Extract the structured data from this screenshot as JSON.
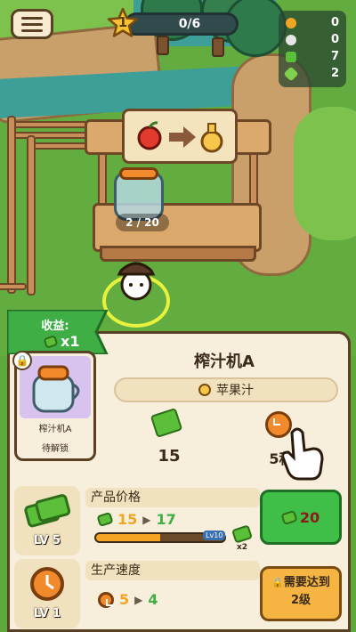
{
  "hud": {
    "level": "1",
    "progress_text": "0/6",
    "resources": [
      {
        "icon": "gold-fruit-icon",
        "value": "0",
        "color": "#f0a623"
      },
      {
        "icon": "cotton-icon",
        "value": "0",
        "color": "#e6e6e6"
      },
      {
        "icon": "cash-icon",
        "value": "7",
        "color": "#5bbf3a"
      },
      {
        "icon": "gem-icon",
        "value": "2",
        "color": "#7fd14d"
      }
    ]
  },
  "stand": {
    "juice_count": "2 / 20"
  },
  "panel": {
    "income_label": "收益:",
    "income_value": "x1",
    "machine_name": "榨汁机A",
    "card_name": "榨汁机A",
    "card_status": "待解锁",
    "product": "苹果汁",
    "stat_cost": "15",
    "stat_time": "5秒",
    "upgrades": [
      {
        "label": "产品价格",
        "level": "LV 5",
        "from": "15",
        "to": "17",
        "progress_pct": 50,
        "level_tag": "Lv10",
        "bonus": "x2",
        "button_text": "20"
      },
      {
        "label": "生产速度",
        "level": "LV 1",
        "from": "5",
        "to": "4",
        "button_text_line1": "需要达到",
        "button_text_line2": "2级"
      }
    ]
  }
}
